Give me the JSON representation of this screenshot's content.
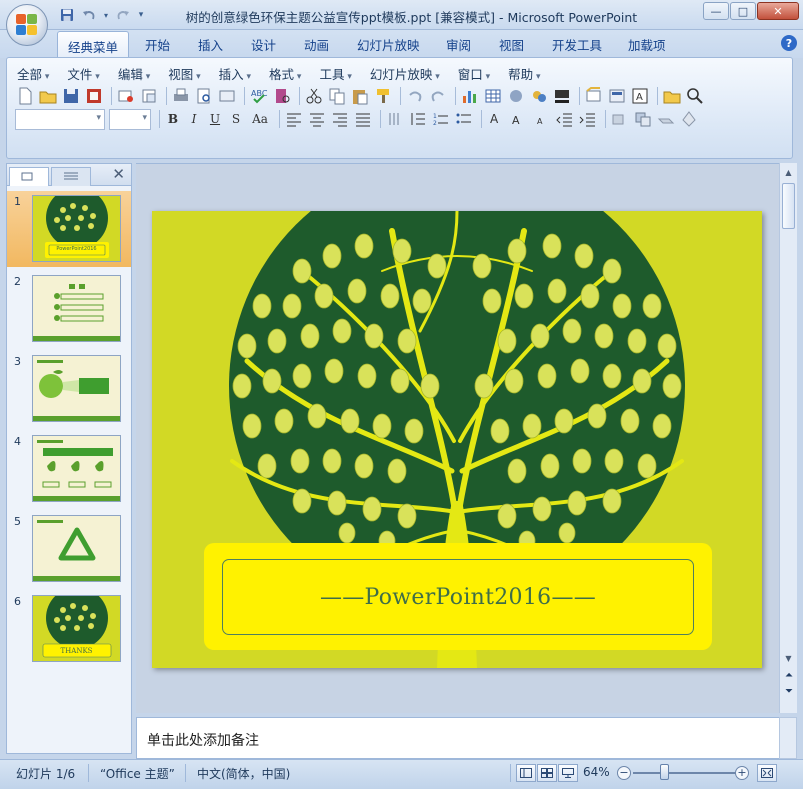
{
  "window": {
    "title": "树的创意绿色环保主题公益宣传ppt模板.ppt [兼容模式] - Microsoft PowerPoint",
    "controls": {
      "minimize": "—",
      "maximize": "□",
      "close": "✕"
    }
  },
  "ribbon_tabs": [
    "经典菜单",
    "开始",
    "插入",
    "设计",
    "动画",
    "幻灯片放映",
    "审阅",
    "视图",
    "开发工具",
    "加载项"
  ],
  "active_tab": "经典菜单",
  "help_label": "?",
  "classic_menu": [
    "全部",
    "文件",
    "编辑",
    "视图",
    "插入",
    "格式",
    "工具",
    "幻灯片放映",
    "窗口",
    "帮助"
  ],
  "format_buttons": {
    "bold": "B",
    "italic": "I",
    "underline": "U",
    "shadow": "S",
    "case": "Aa"
  },
  "thumbnails_pane": {
    "close_label": "✕",
    "slides": [
      {
        "num": "1",
        "caption": "PowerPoint2016",
        "selected": true
      },
      {
        "num": "2",
        "caption": "",
        "selected": false
      },
      {
        "num": "3",
        "caption": "",
        "selected": false
      },
      {
        "num": "4",
        "caption": "",
        "selected": false
      },
      {
        "num": "5",
        "caption": "",
        "selected": false
      },
      {
        "num": "6",
        "caption": "THANKS",
        "selected": false
      }
    ]
  },
  "slide": {
    "title": "——PowerPoint2016——",
    "background_color": "#d2d925",
    "circle_color": "#1e5b2c",
    "leaf_color": "#d9e25a",
    "title_box_color": "#fff200"
  },
  "notes": {
    "placeholder": "单击此处添加备注"
  },
  "status_bar": {
    "slide_counter": "幻灯片 1/6",
    "theme": "“Office 主题”",
    "language": "中文(简体，中国)",
    "zoom": "64%",
    "zoom_out": "−",
    "zoom_in": "+"
  }
}
